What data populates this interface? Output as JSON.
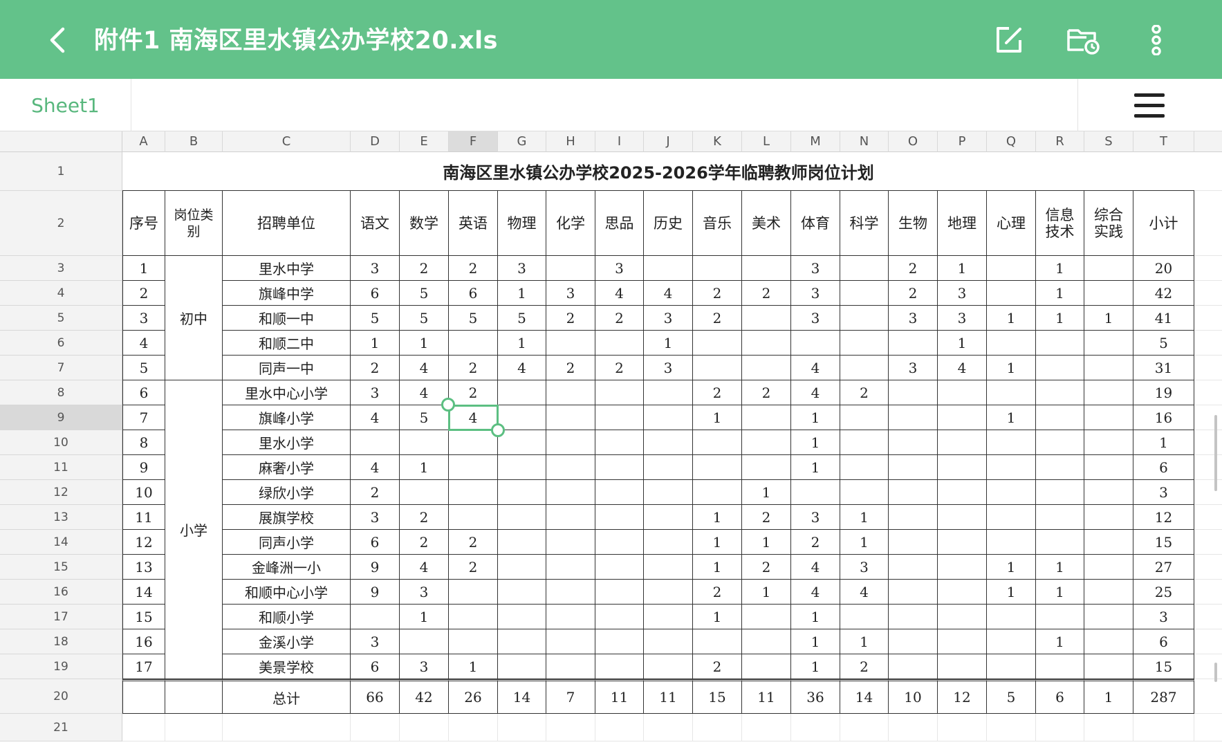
{
  "appbar": {
    "title": "附件1 南海区里水镇公办学校20.xls",
    "color": "#63c28a",
    "icons": [
      "back-arrow-icon",
      "edit-icon",
      "folder-history-icon",
      "more-vertical-icon"
    ]
  },
  "sheet_tab": "Sheet1",
  "columns": [
    "A",
    "B",
    "C",
    "D",
    "E",
    "F",
    "G",
    "H",
    "I",
    "J",
    "K",
    "L",
    "M",
    "N",
    "O",
    "P",
    "Q",
    "R",
    "S",
    "T"
  ],
  "row_numbers": [
    "1",
    "2",
    "3",
    "4",
    "5",
    "6",
    "7",
    "8",
    "9",
    "10",
    "11",
    "12",
    "13",
    "14",
    "15",
    "16",
    "17",
    "18",
    "19",
    "20",
    "21"
  ],
  "sheet_title": "南海区里水镇公办学校2025-2026学年临聘教师岗位计划",
  "headers": [
    "序号",
    "岗位类别",
    "招聘单位",
    "语文",
    "数学",
    "英语",
    "物理",
    "化学",
    "思品",
    "历史",
    "音乐",
    "美术",
    "体育",
    "科学",
    "生物",
    "地理",
    "心理",
    "信息技术",
    "综合实践",
    "小计"
  ],
  "categories": {
    "junior": "初中",
    "primary": "小学"
  },
  "rows": [
    [
      "1",
      "",
      "里水中学",
      "3",
      "2",
      "2",
      "3",
      "",
      "3",
      "",
      "",
      "",
      "3",
      "",
      "2",
      "1",
      "",
      "1",
      "",
      "20"
    ],
    [
      "2",
      "",
      "旗峰中学",
      "6",
      "5",
      "6",
      "1",
      "3",
      "4",
      "4",
      "2",
      "2",
      "3",
      "",
      "2",
      "3",
      "",
      "1",
      "",
      "42"
    ],
    [
      "3",
      "",
      "和顺一中",
      "5",
      "5",
      "5",
      "5",
      "2",
      "2",
      "3",
      "2",
      "",
      "3",
      "",
      "3",
      "3",
      "1",
      "1",
      "1",
      "41"
    ],
    [
      "4",
      "",
      "和顺二中",
      "1",
      "1",
      "",
      "1",
      "",
      "",
      "1",
      "",
      "",
      "",
      "",
      "",
      "1",
      "",
      "",
      "",
      "5"
    ],
    [
      "5",
      "",
      "同声一中",
      "2",
      "4",
      "2",
      "4",
      "2",
      "2",
      "3",
      "",
      "",
      "4",
      "",
      "3",
      "4",
      "1",
      "",
      "",
      "31"
    ],
    [
      "6",
      "",
      "里水中心小学",
      "3",
      "4",
      "2",
      "",
      "",
      "",
      "",
      "2",
      "2",
      "4",
      "2",
      "",
      "",
      "",
      "",
      "",
      "19"
    ],
    [
      "7",
      "",
      "旗峰小学",
      "4",
      "5",
      "4",
      "",
      "",
      "",
      "",
      "1",
      "",
      "1",
      "",
      "",
      "",
      "1",
      "",
      "",
      "16"
    ],
    [
      "8",
      "",
      "里水小学",
      "",
      "",
      "",
      "",
      "",
      "",
      "",
      "",
      "",
      "1",
      "",
      "",
      "",
      "",
      "",
      "",
      "1"
    ],
    [
      "9",
      "",
      "麻奢小学",
      "4",
      "1",
      "",
      "",
      "",
      "",
      "",
      "",
      "",
      "1",
      "",
      "",
      "",
      "",
      "",
      "",
      "6"
    ],
    [
      "10",
      "",
      "绿欣小学",
      "2",
      "",
      "",
      "",
      "",
      "",
      "",
      "",
      "1",
      "",
      "",
      "",
      "",
      "",
      "",
      "",
      "3"
    ],
    [
      "11",
      "",
      "展旗学校",
      "3",
      "2",
      "",
      "",
      "",
      "",
      "",
      "1",
      "2",
      "3",
      "1",
      "",
      "",
      "",
      "",
      "",
      "12"
    ],
    [
      "12",
      "",
      "同声小学",
      "6",
      "2",
      "2",
      "",
      "",
      "",
      "",
      "1",
      "1",
      "2",
      "1",
      "",
      "",
      "",
      "",
      "",
      "15"
    ],
    [
      "13",
      "",
      "金峰洲一小",
      "9",
      "4",
      "2",
      "",
      "",
      "",
      "",
      "1",
      "2",
      "4",
      "3",
      "",
      "",
      "1",
      "1",
      "",
      "27"
    ],
    [
      "14",
      "",
      "和顺中心小学",
      "9",
      "3",
      "",
      "",
      "",
      "",
      "",
      "2",
      "1",
      "4",
      "4",
      "",
      "",
      "1",
      "1",
      "",
      "25"
    ],
    [
      "15",
      "",
      "和顺小学",
      "",
      "1",
      "",
      "",
      "",
      "",
      "",
      "1",
      "",
      "1",
      "",
      "",
      "",
      "",
      "",
      "",
      "3"
    ],
    [
      "16",
      "",
      "金溪小学",
      "3",
      "",
      "",
      "",
      "",
      "",
      "",
      "",
      "",
      "1",
      "1",
      "",
      "",
      "",
      "1",
      "",
      "6"
    ],
    [
      "17",
      "",
      "美景学校",
      "6",
      "3",
      "1",
      "",
      "",
      "",
      "",
      "2",
      "",
      "1",
      "2",
      "",
      "",
      "",
      "",
      "",
      "15"
    ]
  ],
  "total_row": [
    "",
    "",
    "总计",
    "66",
    "42",
    "26",
    "14",
    "7",
    "11",
    "11",
    "15",
    "11",
    "36",
    "14",
    "10",
    "12",
    "5",
    "6",
    "1",
    "287"
  ],
  "selected_cell": "F9",
  "accent": "#5cbf82"
}
